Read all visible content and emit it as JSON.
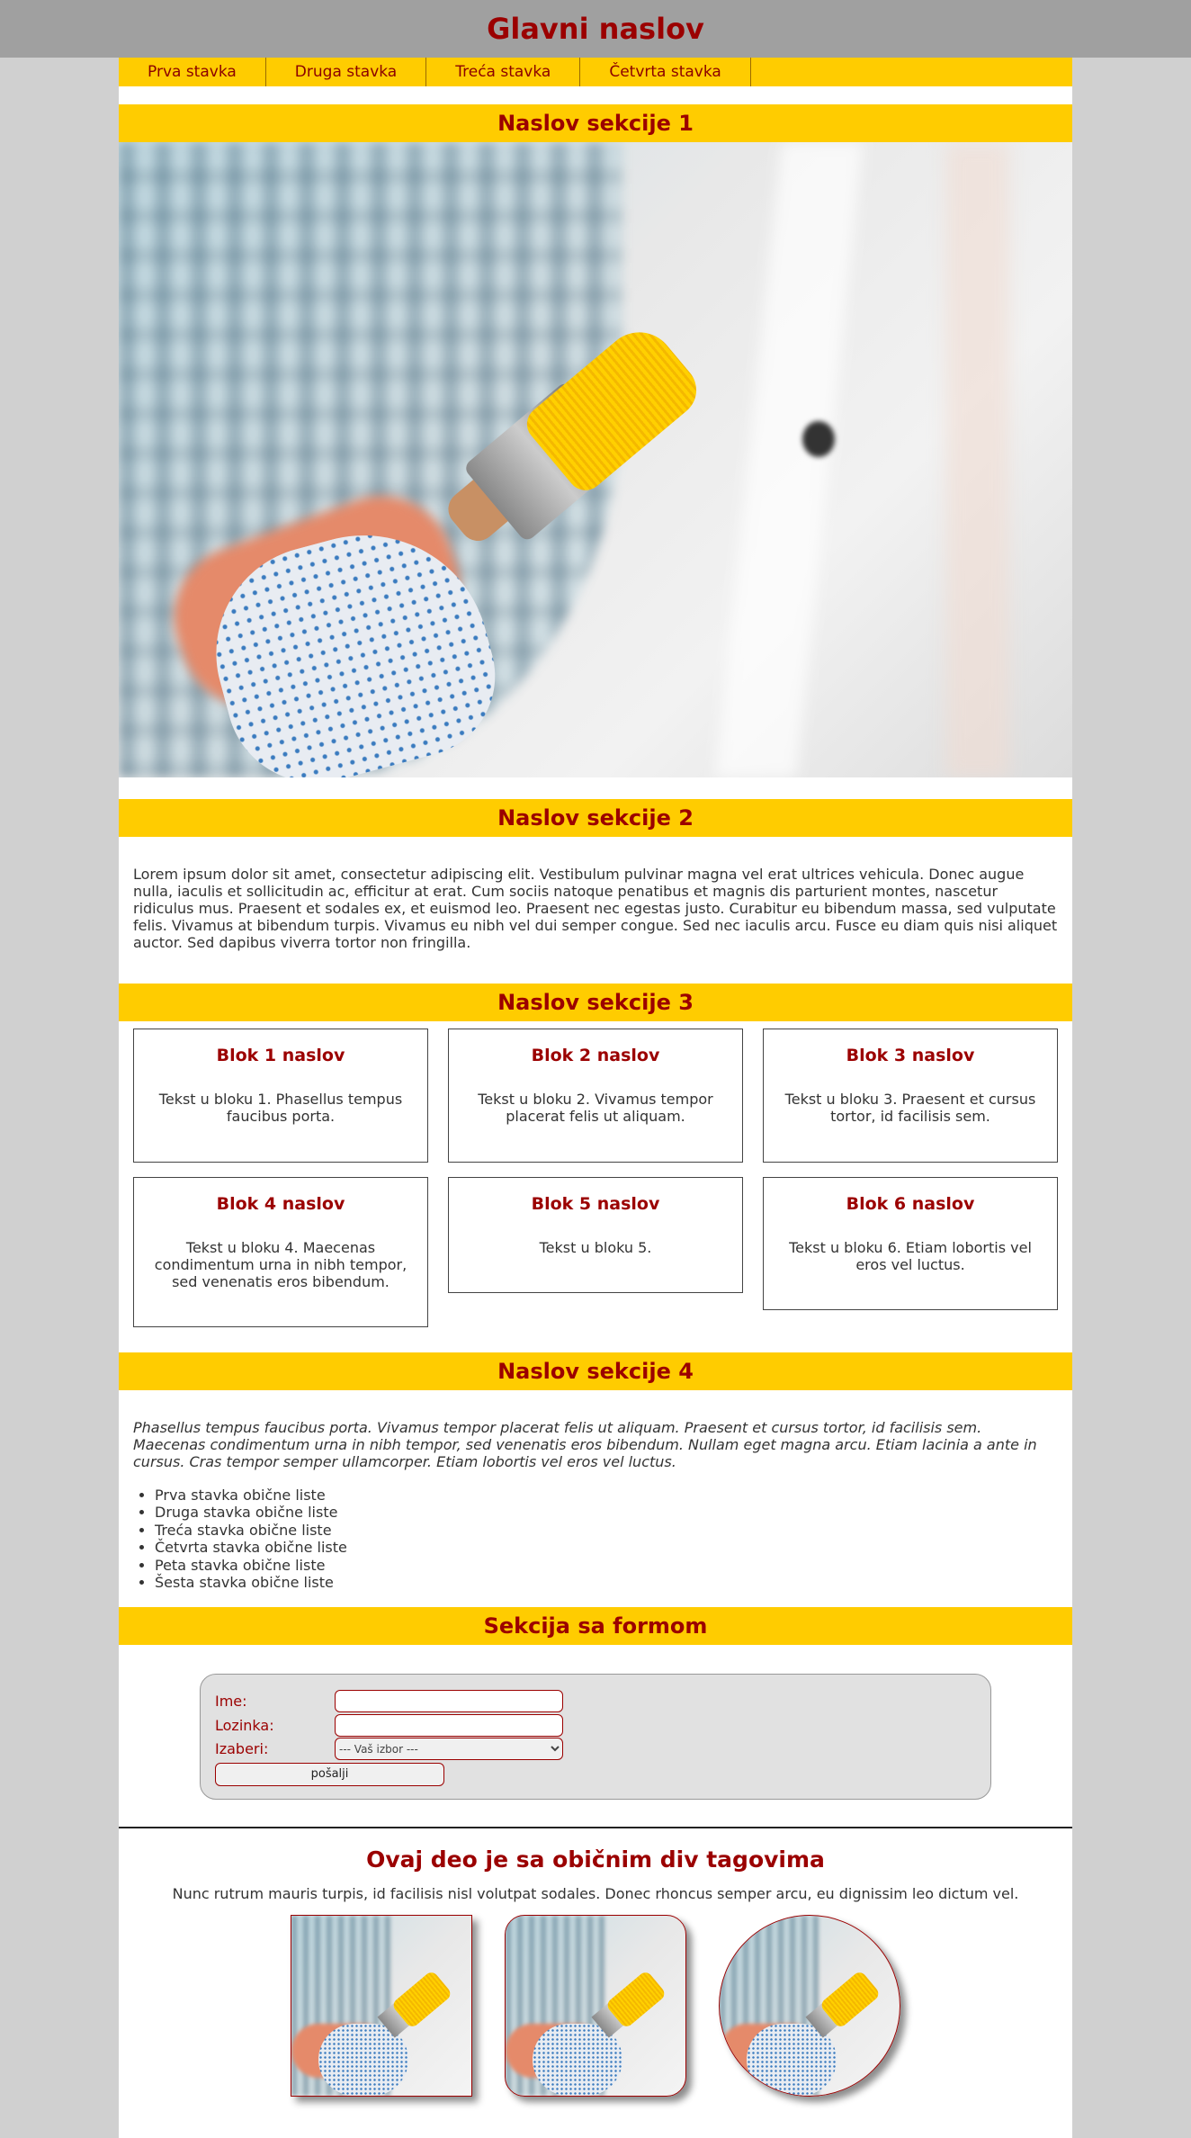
{
  "header": {
    "title": "Glavni naslov"
  },
  "nav": {
    "items": [
      "Prva stavka",
      "Druga stavka",
      "Treća stavka",
      "Četvrta stavka"
    ]
  },
  "section1": {
    "title": "Naslov sekcije 1"
  },
  "section2": {
    "title": "Naslov sekcije 2",
    "text": "Lorem ipsum dolor sit amet, consectetur adipiscing elit. Vestibulum pulvinar magna vel erat ultrices vehicula. Donec augue nulla, iaculis et sollicitudin ac, efficitur at erat. Cum sociis natoque penatibus et magnis dis parturient montes, nascetur ridiculus mus. Praesent et sodales ex, et euismod leo. Praesent nec egestas justo. Curabitur eu bibendum massa, sed vulputate felis. Vivamus at bibendum turpis. Vivamus eu nibh vel dui semper congue. Sed nec iaculis arcu. Fusce eu diam quis nisi aliquet auctor. Sed dapibus viverra tortor non fringilla."
  },
  "section3": {
    "title": "Naslov sekcije 3",
    "blocks": [
      {
        "title": "Blok 1 naslov",
        "text": "Tekst u bloku 1. Phasellus tempus faucibus porta."
      },
      {
        "title": "Blok 2 naslov",
        "text": "Tekst u bloku 2. Vivamus tempor placerat felis ut aliquam."
      },
      {
        "title": "Blok 3 naslov",
        "text": "Tekst u bloku 3. Praesent et cursus tortor, id facilisis sem."
      },
      {
        "title": "Blok 4 naslov",
        "text": "Tekst u bloku 4. Maecenas condimentum urna in nibh tempor, sed venenatis eros bibendum."
      },
      {
        "title": "Blok 5 naslov",
        "text": "Tekst u bloku 5."
      },
      {
        "title": "Blok 6 naslov",
        "text": "Tekst u bloku 6. Etiam lobortis vel eros vel luctus."
      }
    ]
  },
  "section4": {
    "title": "Naslov sekcije 4",
    "text": "Phasellus tempus faucibus porta. Vivamus tempor placerat felis ut aliquam. Praesent et cursus tortor, id facilisis sem. Maecenas condimentum urna in nibh tempor, sed venenatis eros bibendum. Nullam eget magna arcu. Etiam lacinia a ante in cursus. Cras tempor semper ullamcorper. Etiam lobortis vel eros vel luctus.",
    "list": [
      "Prva stavka obične liste",
      "Druga stavka obične liste",
      "Treća stavka obične liste",
      "Četvrta stavka obične liste",
      "Peta stavka obične liste",
      "Šesta stavka obične liste"
    ]
  },
  "form_section": {
    "title": "Sekcija sa formom",
    "name_label": "Ime:",
    "name_value": "",
    "password_label": "Lozinka:",
    "password_value": "",
    "select_label": "Izaberi:",
    "select_value": "--- Vaš izbor ---",
    "submit_label": "pošalji"
  },
  "div_section": {
    "title": "Ovaj deo je sa običnim div tagovima",
    "text": "Nunc rutrum mauris turpis, id facilisis nisl volutpat sodales. Donec rhoncus semper arcu, eu dignissim leo dictum vel."
  },
  "colors": {
    "accent": "#ffcc00",
    "heading": "#9b0000",
    "header_bg": "#a0a0a0",
    "page_bg": "#d0d0d0"
  }
}
